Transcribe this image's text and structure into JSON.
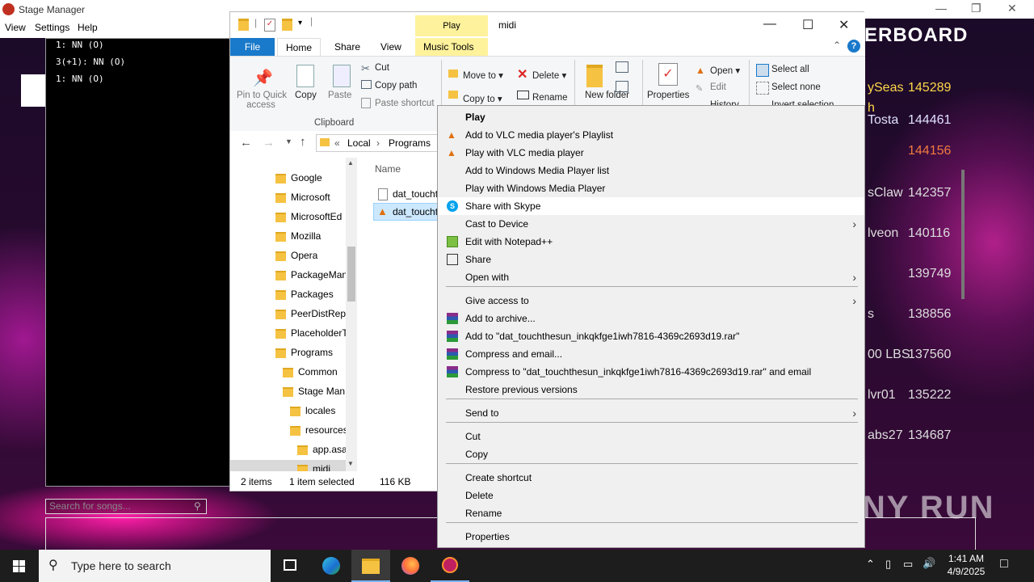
{
  "stage_manager": {
    "title": "Stage Manager",
    "menu": [
      "View",
      "Settings",
      "Help"
    ],
    "console_lines": [
      "1: NN (O)",
      "3(+1): NN (O)",
      "1: NN (O)"
    ]
  },
  "game": {
    "search_placeholder": "Search for songs...",
    "leaderboard_title": "ERBOARD",
    "leaderboard": [
      {
        "name": "ySeas",
        "score": "145289",
        "name_color": "#ffd84a",
        "score_color": "#ffd84a"
      },
      {
        "name": "h",
        "score": "",
        "name_color": "#ffd84a",
        "score_color": "#ffd84a"
      },
      {
        "name": "Tosta",
        "score": "144461",
        "name_color": "#e0e0ff",
        "score_color": "#e0e0ff"
      },
      {
        "name": "",
        "score": "144156",
        "name_color": "#f07a40",
        "score_color": "#f07a40"
      },
      {
        "name": "sClaw",
        "score": "142357",
        "name_color": "#dddddd",
        "score_color": "#dddddd"
      },
      {
        "name": "lveon",
        "score": "140116",
        "name_color": "#dddddd",
        "score_color": "#dddddd"
      },
      {
        "name": "",
        "score": "139749",
        "name_color": "#dddddd",
        "score_color": "#dddddd"
      },
      {
        "name": "s",
        "score": "138856",
        "name_color": "#dddddd",
        "score_color": "#dddddd"
      },
      {
        "name": "00 LBS",
        "score": "137560",
        "name_color": "#dddddd",
        "score_color": "#dddddd"
      },
      {
        "name": "lvr01",
        "score": "135222",
        "name_color": "#dddddd",
        "score_color": "#dddddd"
      },
      {
        "name": "abs27",
        "score": "134687",
        "name_color": "#dddddd",
        "score_color": "#dddddd"
      }
    ],
    "watermark": "ANY RUN"
  },
  "explorer": {
    "title": "midi",
    "contextual_tab_group": "Play",
    "tabs": {
      "file": "File",
      "home": "Home",
      "share": "Share",
      "view": "View",
      "music_tools": "Music Tools"
    },
    "ribbon": {
      "pin": "Pin to Quick access",
      "pin_l1": "Pin to Quick",
      "pin_l2": "access",
      "copy": "Copy",
      "paste": "Paste",
      "cut": "Cut",
      "copy_path": "Copy path",
      "paste_shortcut": "Paste shortcut",
      "clipboard_group": "Clipboard",
      "move_to": "Move to",
      "copy_to": "Copy to",
      "delete": "Delete",
      "rename": "Rename",
      "new_folder": "New folder",
      "properties": "Properties",
      "open": "Open",
      "edit": "Edit",
      "history": "History",
      "select_all": "Select all",
      "select_none": "Select none",
      "invert_selection": "Invert selection"
    },
    "breadcrumb": [
      "Local",
      "Programs"
    ],
    "nav_items": [
      {
        "label": "Google",
        "indent": 0
      },
      {
        "label": "Microsoft",
        "indent": 0
      },
      {
        "label": "MicrosoftEd",
        "indent": 0
      },
      {
        "label": "Mozilla",
        "indent": 0
      },
      {
        "label": "Opera",
        "indent": 0
      },
      {
        "label": "PackageMan",
        "indent": 0
      },
      {
        "label": "Packages",
        "indent": 0
      },
      {
        "label": "PeerDistRep",
        "indent": 0
      },
      {
        "label": "PlaceholderT",
        "indent": 0
      },
      {
        "label": "Programs",
        "indent": 0
      },
      {
        "label": "Common",
        "indent": 1
      },
      {
        "label": "Stage Man",
        "indent": 1
      },
      {
        "label": "locales",
        "indent": 2
      },
      {
        "label": "resources",
        "indent": 2
      },
      {
        "label": "app.asa",
        "indent": 3
      },
      {
        "label": "midi",
        "indent": 3
      }
    ],
    "column_name": "Name",
    "files": [
      "dat_toucht",
      "dat_toucht"
    ],
    "status": {
      "items": "2 items",
      "selected": "1 item selected",
      "size": "116 KB"
    }
  },
  "context_menu": {
    "items": [
      {
        "label": "Play",
        "bold": true,
        "icon": "",
        "arrow": false,
        "y": 14
      },
      {
        "label": "Add to VLC media player's Playlist",
        "icon": "vlc-icon",
        "arrow": false
      },
      {
        "label": "Play with VLC media player",
        "icon": "vlc-icon",
        "arrow": false
      },
      {
        "label": "Add to Windows Media Player list",
        "icon": "",
        "arrow": false
      },
      {
        "label": "Play with Windows Media Player",
        "icon": "",
        "arrow": false
      },
      {
        "label": "Share with Skype",
        "icon": "skype-icon",
        "arrow": false,
        "highlight": true
      },
      {
        "label": "Cast to Device",
        "icon": "",
        "arrow": true
      },
      {
        "label": "Edit with Notepad++",
        "icon": "notepadpp-icon",
        "arrow": false
      },
      {
        "label": "Share",
        "icon": "share-icon",
        "arrow": false
      },
      {
        "label": "Open with",
        "icon": "",
        "arrow": true
      },
      {
        "label": "Give access to",
        "icon": "",
        "arrow": true
      },
      {
        "label": "Add to archive...",
        "icon": "winrar-icon",
        "arrow": false
      },
      {
        "label": "Add to \"dat_touchthesun_inkqkfge1iwh7816-4369c2693d19.rar\"",
        "icon": "winrar-icon",
        "arrow": false
      },
      {
        "label": "Compress and email...",
        "icon": "winrar-icon",
        "arrow": false
      },
      {
        "label": "Compress to \"dat_touchthesun_inkqkfge1iwh7816-4369c2693d19.rar\" and email",
        "icon": "winrar-icon",
        "arrow": false
      },
      {
        "label": "Restore previous versions",
        "icon": "",
        "arrow": false
      },
      {
        "label": "Send to",
        "icon": "",
        "arrow": true
      },
      {
        "label": "Cut",
        "icon": "",
        "arrow": false
      },
      {
        "label": "Copy",
        "icon": "",
        "arrow": false
      },
      {
        "label": "Create shortcut",
        "icon": "",
        "arrow": false
      },
      {
        "label": "Delete",
        "icon": "",
        "arrow": false
      },
      {
        "label": "Rename",
        "icon": "",
        "arrow": false
      },
      {
        "label": "Properties",
        "icon": "",
        "arrow": false
      }
    ]
  },
  "taskbar": {
    "search_placeholder": "Type here to search",
    "time": "1:41 AM",
    "date": "4/9/2025"
  }
}
